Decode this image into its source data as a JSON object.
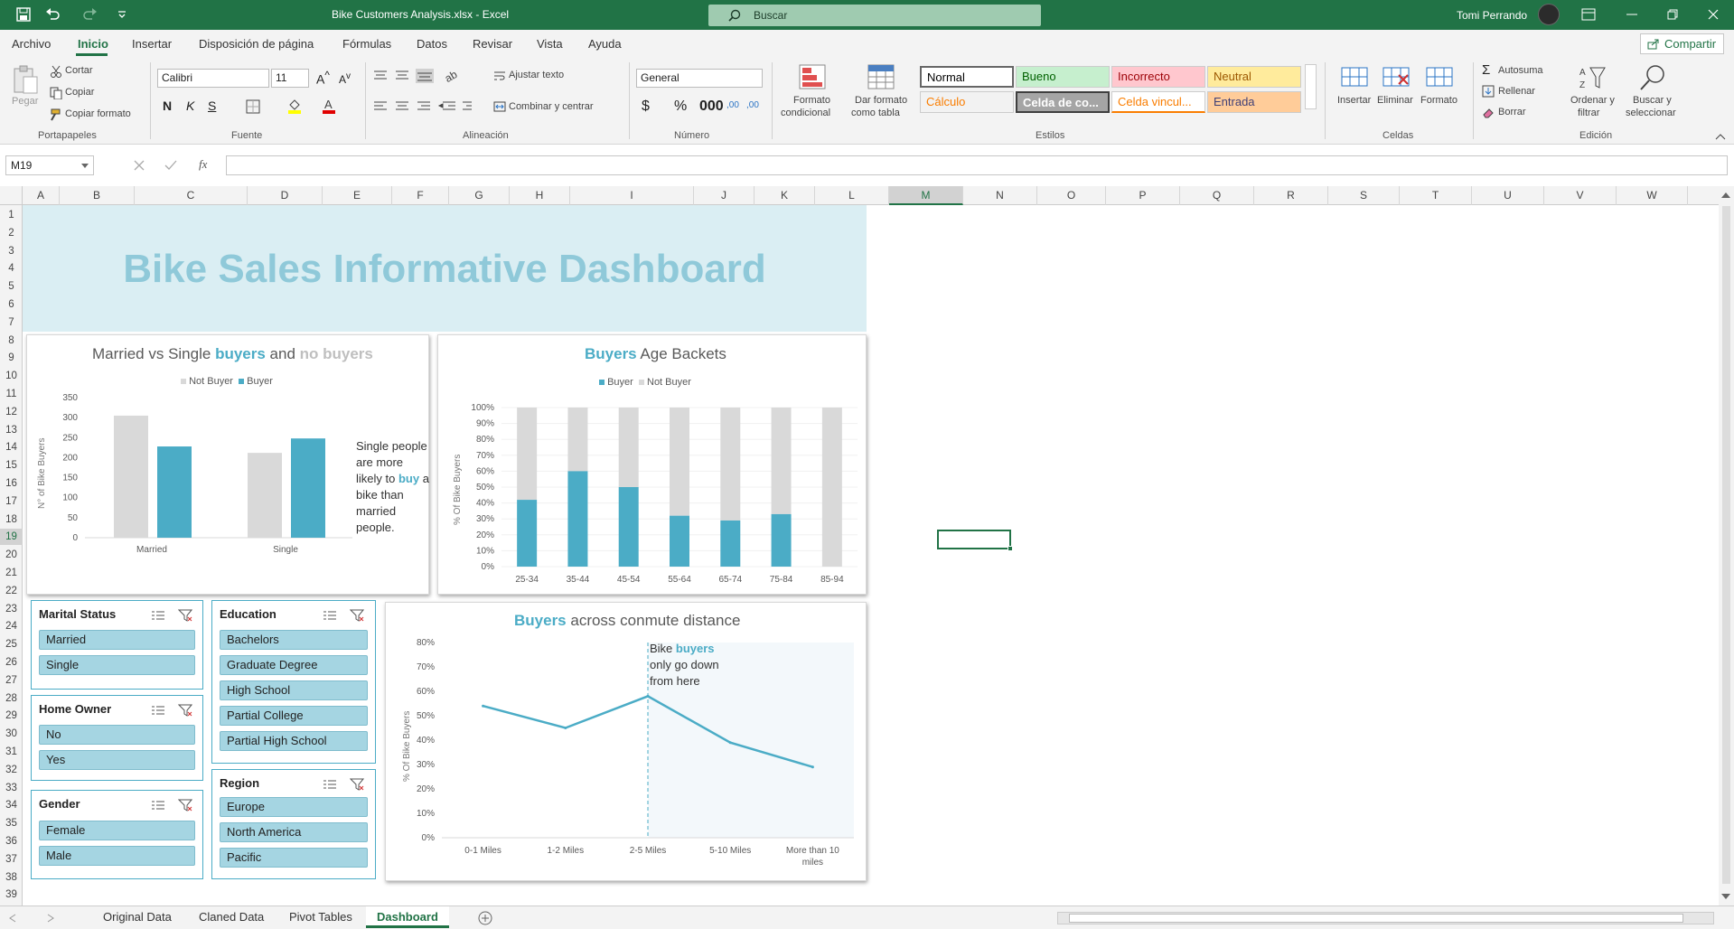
{
  "window": {
    "title": "Bike Customers Analysis.xlsx  -  Excel",
    "search_placeholder": "Buscar",
    "user": "Tomi Perrando"
  },
  "menu": [
    "Archivo",
    "Inicio",
    "Insertar",
    "Disposición de página",
    "Fórmulas",
    "Datos",
    "Revisar",
    "Vista",
    "Ayuda"
  ],
  "share_label": "Compartir",
  "ribbon": {
    "clipboard": {
      "paste": "Pegar",
      "cut": "Cortar",
      "copy": "Copiar",
      "format_painter": "Copiar formato",
      "group": "Portapapeles"
    },
    "font": {
      "name": "Calibri",
      "size": "11",
      "group": "Fuente"
    },
    "alignment": {
      "wrap": "Ajustar texto",
      "merge": "Combinar y centrar",
      "group": "Alineación"
    },
    "number": {
      "format": "General",
      "group": "Número"
    },
    "styles": {
      "cond_format_1": "Formato",
      "cond_format_2": "condicional",
      "table_format_1": "Dar formato",
      "table_format_2": "como tabla",
      "cells": [
        {
          "label": "Normal",
          "bg": "#ffffff",
          "fg": "#000000"
        },
        {
          "label": "Bueno",
          "bg": "#c6efce",
          "fg": "#006100"
        },
        {
          "label": "Incorrecto",
          "bg": "#ffc7ce",
          "fg": "#9c0006"
        },
        {
          "label": "Neutral",
          "bg": "#ffeb9c",
          "fg": "#9c5700"
        },
        {
          "label": "Cálculo",
          "bg": "#f2f2f2",
          "fg": "#fa7d00"
        },
        {
          "label": "Celda de co...",
          "bg": "#a5a5a5",
          "fg": "#ffffff"
        },
        {
          "label": "Celda vincul...",
          "bg": "#ffffff",
          "fg": "#fa7d00"
        },
        {
          "label": "Entrada",
          "bg": "#ffcc99",
          "fg": "#3f3f76"
        }
      ],
      "group": "Estilos"
    },
    "cells": {
      "insert": "Insertar",
      "delete": "Eliminar",
      "format": "Formato",
      "group": "Celdas"
    },
    "editing": {
      "autosum": "Autosuma",
      "fill": "Rellenar",
      "clear": "Borrar",
      "sort_1": "Ordenar y",
      "sort_2": "filtrar",
      "find_1": "Buscar y",
      "find_2": "seleccionar",
      "group": "Edición"
    }
  },
  "formula_bar": {
    "name_box": "M19",
    "formula": ""
  },
  "columns": [
    "A",
    "B",
    "C",
    "D",
    "E",
    "F",
    "G",
    "H",
    "I",
    "J",
    "K",
    "L",
    "M",
    "N",
    "O",
    "P",
    "Q",
    "R",
    "S",
    "T",
    "U",
    "V",
    "W"
  ],
  "rows": [
    "1",
    "2",
    "3",
    "4",
    "5",
    "6",
    "7",
    "8",
    "9",
    "10",
    "11",
    "12",
    "13",
    "14",
    "15",
    "16",
    "17",
    "18",
    "19",
    "20",
    "21",
    "22",
    "23",
    "24",
    "25",
    "26",
    "27",
    "28",
    "29",
    "30",
    "31",
    "32",
    "33",
    "34",
    "35",
    "36",
    "37",
    "38",
    "39"
  ],
  "dashboard": {
    "title": "Bike Sales Informative Dashboard"
  },
  "chart1": {
    "title_parts": [
      "Married vs Single ",
      "buyers",
      " and ",
      "no buyers"
    ],
    "legend": [
      "Not Buyer",
      "Buyer"
    ],
    "ylabel": "N° of Bike Buyers",
    "annotation_parts": [
      "Single people are more likely to ",
      "buy",
      " a bike than married people."
    ]
  },
  "chart2": {
    "title_parts": [
      "Buyers",
      " Age Backets"
    ],
    "legend": [
      "Buyer",
      "Not Buyer"
    ],
    "ylabel": "% Of Bike Buyers"
  },
  "chart3": {
    "title_parts": [
      "Buyers",
      " across conmute distance"
    ],
    "ylabel": "% Of Bike Buyers",
    "annotation_parts": [
      "Bike ",
      "buyers",
      " only go down from here"
    ]
  },
  "chart_data": [
    {
      "type": "bar",
      "categories": [
        "Married",
        "Single"
      ],
      "series": [
        {
          "name": "Not Buyer",
          "values": [
            305,
            212
          ]
        },
        {
          "name": "Buyer",
          "values": [
            228,
            248
          ]
        }
      ],
      "ylim": [
        0,
        350
      ],
      "yticks": [
        0,
        50,
        100,
        150,
        200,
        250,
        300,
        350
      ],
      "colors": {
        "Not Buyer": "#d9d9d9",
        "Buyer": "#4bacc6"
      }
    },
    {
      "type": "bar",
      "stacked": "percent",
      "categories": [
        "25-34",
        "35-44",
        "45-54",
        "55-64",
        "65-74",
        "75-84",
        "85-94"
      ],
      "series": [
        {
          "name": "Buyer",
          "values": [
            42,
            60,
            50,
            32,
            29,
            33,
            0
          ]
        },
        {
          "name": "Not Buyer",
          "values": [
            58,
            40,
            50,
            68,
            71,
            67,
            100
          ]
        }
      ],
      "ylim": [
        0,
        100
      ],
      "yticks": [
        "0%",
        "10%",
        "20%",
        "30%",
        "40%",
        "50%",
        "60%",
        "70%",
        "80%",
        "90%",
        "100%"
      ],
      "colors": {
        "Buyer": "#4bacc6",
        "Not Buyer": "#d9d9d9"
      }
    },
    {
      "type": "line",
      "categories": [
        "0-1 Miles",
        "1-2 Miles",
        "2-5 Miles",
        "5-10 Miles",
        "More than 10 miles"
      ],
      "values": [
        54,
        45,
        58,
        39,
        29
      ],
      "ylim": [
        0,
        80
      ],
      "yticks": [
        "0%",
        "10%",
        "20%",
        "30%",
        "40%",
        "50%",
        "60%",
        "70%",
        "80%"
      ],
      "color": "#4bacc6"
    }
  ],
  "slicers": [
    {
      "title": "Marital Status",
      "items": [
        "Married",
        "Single"
      ]
    },
    {
      "title": "Home Owner",
      "items": [
        "No",
        "Yes"
      ]
    },
    {
      "title": "Gender",
      "items": [
        "Female",
        "Male"
      ]
    },
    {
      "title": "Education",
      "items": [
        "Bachelors",
        "Graduate Degree",
        "High School",
        "Partial College",
        "Partial High School"
      ]
    },
    {
      "title": "Region",
      "items": [
        "Europe",
        "North America",
        "Pacific"
      ]
    }
  ],
  "sheets": [
    "Original Data",
    "Claned Data",
    "Pivot Tables",
    "Dashboard"
  ],
  "active_sheet": "Dashboard",
  "accent": "#217346"
}
